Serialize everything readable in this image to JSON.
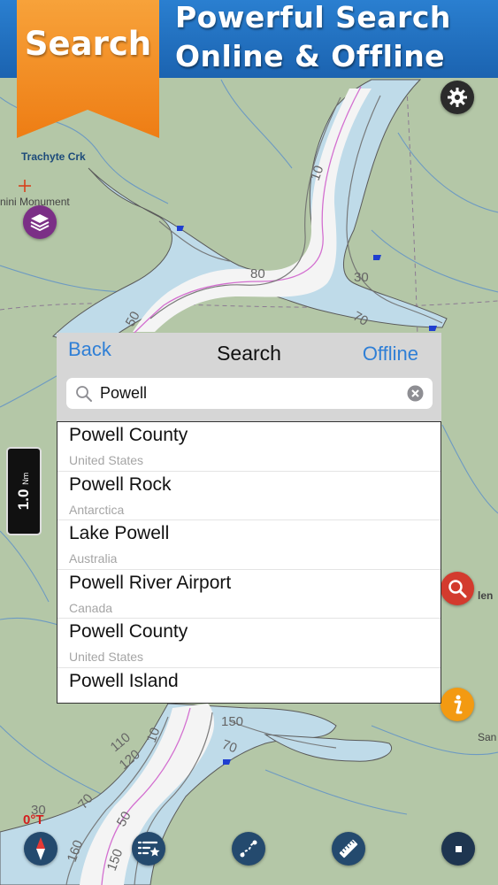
{
  "banner": {
    "ribbon_label": "Search",
    "headline_1": "Powerful Search",
    "headline_2": "Online & Offline"
  },
  "map_labels": {
    "creek": "Trachyte Crk",
    "monument": "nini Monument",
    "edge_right_1": "len",
    "edge_right_2": "San",
    "compass_heading": "0°T"
  },
  "scale": {
    "value": "1.0",
    "unit": "Nm"
  },
  "search_panel": {
    "back_label": "Back",
    "title": "Search",
    "offline_label": "Offline",
    "query": "Powell",
    "results": [
      {
        "name": "Powell County",
        "region": "United States"
      },
      {
        "name": "Powell Rock",
        "region": "Antarctica"
      },
      {
        "name": "Lake Powell",
        "region": "Australia"
      },
      {
        "name": "Powell River Airport",
        "region": "Canada"
      },
      {
        "name": "Powell County",
        "region": "United States"
      },
      {
        "name": "Powell Island",
        "region": ""
      }
    ]
  },
  "colors": {
    "banner_blue": "#1b63b0",
    "ribbon_orange": "#f08a1c",
    "link_blue": "#2f7fd6",
    "land_green": "#b4c7a7",
    "water_blue": "#bfdbe9",
    "channel_white": "#f4f4f4",
    "toolbar_blue": "#244a6e"
  },
  "icons": [
    "settings-gear-icon",
    "layers-icon",
    "search-icon",
    "clear-icon",
    "magnifier-icon",
    "info-icon",
    "compass-icon",
    "favorites-list-icon",
    "route-icon",
    "measure-ruler-icon",
    "record-stop-icon"
  ]
}
